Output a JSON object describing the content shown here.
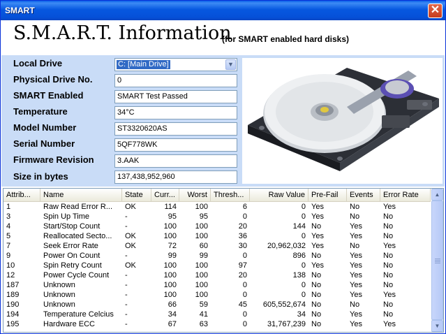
{
  "window": {
    "title": "SMART"
  },
  "header": {
    "title": "S.M.A.R.T. Information",
    "subtitle": "(for SMART enabled hard disks)"
  },
  "info": {
    "fields": [
      {
        "label": "Local Drive",
        "value": "C: [Main Drive]"
      },
      {
        "label": "Physical Drive No.",
        "value": "0"
      },
      {
        "label": "SMART Enabled",
        "value": "SMART Test Passed"
      },
      {
        "label": "Temperature",
        "value": "34°C"
      },
      {
        "label": "Model Number",
        "value": "ST3320620AS"
      },
      {
        "label": "Serial Number",
        "value": "5QF778WK"
      },
      {
        "label": "Firmware Revision",
        "value": "3.AAK"
      },
      {
        "label": "Size in bytes",
        "value": "137,438,952,960"
      }
    ]
  },
  "table": {
    "columns": [
      "Attrib...",
      "Name",
      "State",
      "Curr...",
      "Worst",
      "Thresh...",
      "Raw Value",
      "Pre-Fail",
      "Events",
      "Error Rate"
    ],
    "rows": [
      [
        "1",
        "Raw Read Error R...",
        "OK",
        "114",
        "100",
        "6",
        "0",
        "Yes",
        "No",
        "Yes"
      ],
      [
        "3",
        "Spin Up Time",
        "-",
        "95",
        "95",
        "0",
        "0",
        "Yes",
        "No",
        "No"
      ],
      [
        "4",
        "Start/Stop Count",
        "-",
        "100",
        "100",
        "20",
        "144",
        "No",
        "Yes",
        "No"
      ],
      [
        "5",
        "Reallocated Secto...",
        "OK",
        "100",
        "100",
        "36",
        "0",
        "Yes",
        "Yes",
        "No"
      ],
      [
        "7",
        "Seek Error Rate",
        "OK",
        "72",
        "60",
        "30",
        "20,962,032",
        "Yes",
        "No",
        "Yes"
      ],
      [
        "9",
        "Power On Count",
        "-",
        "99",
        "99",
        "0",
        "896",
        "No",
        "Yes",
        "No"
      ],
      [
        "10",
        "Spin Retry Count",
        "OK",
        "100",
        "100",
        "97",
        "0",
        "Yes",
        "Yes",
        "No"
      ],
      [
        "12",
        "Power Cycle Count",
        "-",
        "100",
        "100",
        "20",
        "138",
        "No",
        "Yes",
        "No"
      ],
      [
        "187",
        "Unknown",
        "-",
        "100",
        "100",
        "0",
        "0",
        "No",
        "Yes",
        "No"
      ],
      [
        "189",
        "Unknown",
        "-",
        "100",
        "100",
        "0",
        "0",
        "No",
        "Yes",
        "Yes"
      ],
      [
        "190",
        "Unknown",
        "-",
        "66",
        "59",
        "45",
        "605,552,674",
        "No",
        "No",
        "No"
      ],
      [
        "194",
        "Temperature Celcius",
        "-",
        "34",
        "41",
        "0",
        "34",
        "No",
        "Yes",
        "No"
      ],
      [
        "195",
        "Hardware ECC",
        "-",
        "67",
        "63",
        "0",
        "31,767,239",
        "No",
        "Yes",
        "Yes"
      ]
    ]
  },
  "icons": {
    "close": "close-icon",
    "dropdown": "chevron-down-icon",
    "scroll_up": "arrow-up-icon",
    "scroll_down": "arrow-down-icon",
    "image": "hard-drive-image"
  }
}
